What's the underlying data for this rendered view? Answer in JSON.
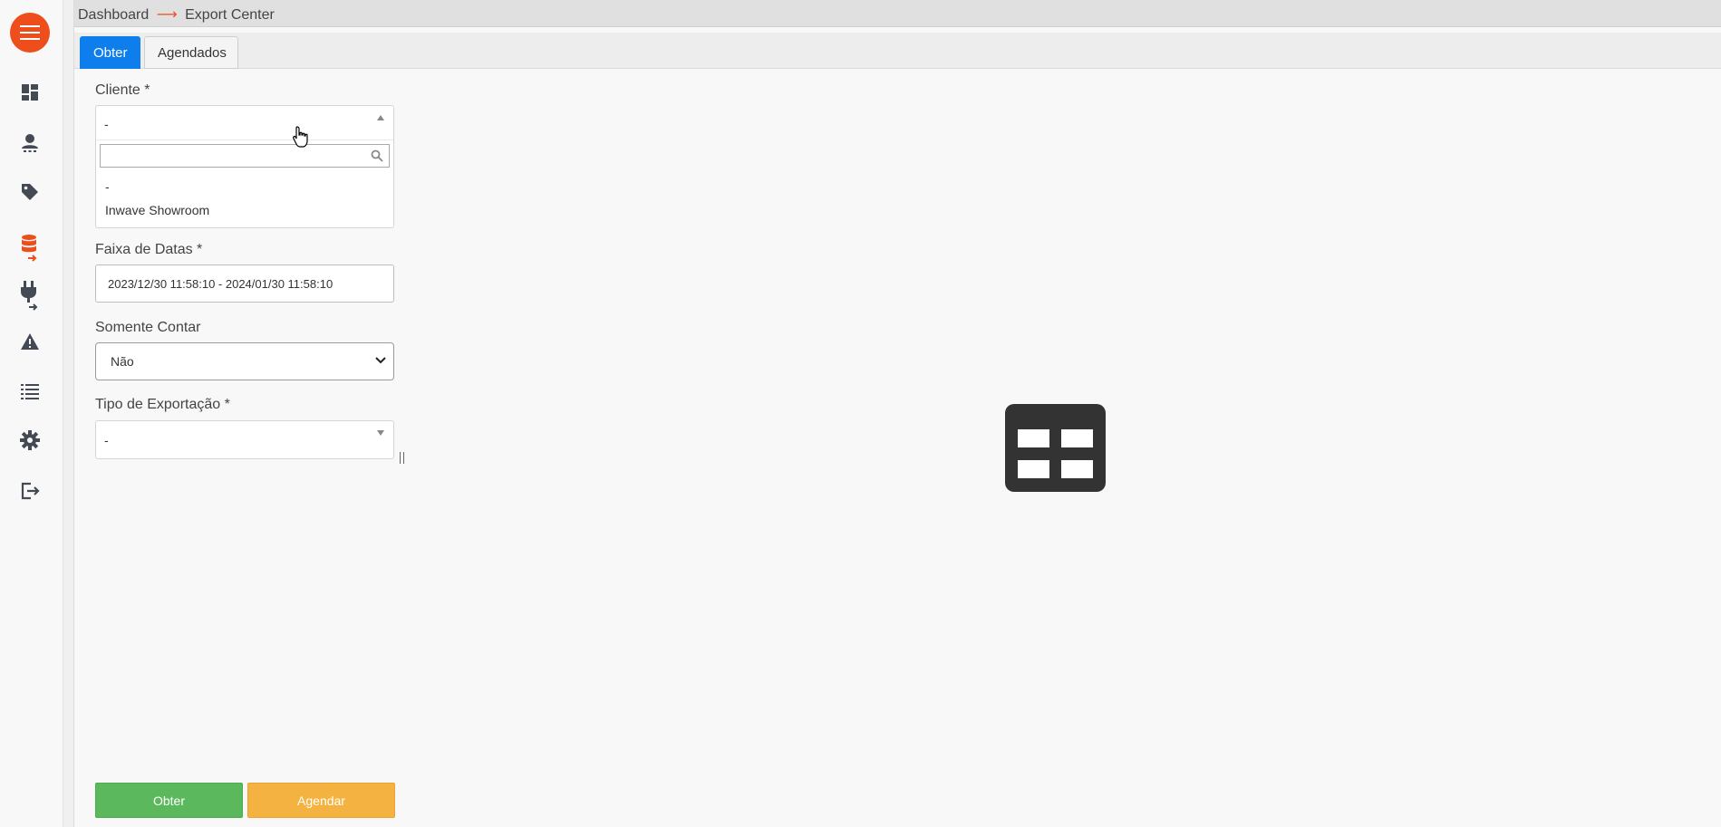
{
  "breadcrumb": {
    "parent": "Dashboard",
    "separator": "⟶",
    "current": "Export Center"
  },
  "tabs": [
    {
      "label": "Obter",
      "active": true
    },
    {
      "label": "Agendados",
      "active": false
    }
  ],
  "form": {
    "cliente": {
      "label": "Cliente *",
      "value": "-",
      "search_value": "",
      "options": [
        "-",
        "Inwave Showroom"
      ]
    },
    "faixa_datas": {
      "label": "Faixa de Datas *",
      "value": "2023/12/30 11:58:10 - 2024/01/30 11:58:10"
    },
    "somente_contar": {
      "label": "Somente Contar",
      "value": "Não"
    },
    "tipo_exportacao": {
      "label": "Tipo de Exportação *",
      "value": "-"
    }
  },
  "actions": {
    "obter_label": "Obter",
    "agendar_label": "Agendar"
  },
  "sidebar": {
    "icons": [
      "menu-icon",
      "dashboard-icon",
      "user-icon",
      "tag-icon",
      "database-export-icon",
      "plug-export-icon",
      "warning-icon",
      "list-icon",
      "gear-icon",
      "logout-icon"
    ]
  },
  "colors": {
    "accent": "#ee4e1c",
    "tab_active": "#0d7eec",
    "button_green": "#5cb85c",
    "button_orange": "#f4b340",
    "icon": "#434a54"
  }
}
